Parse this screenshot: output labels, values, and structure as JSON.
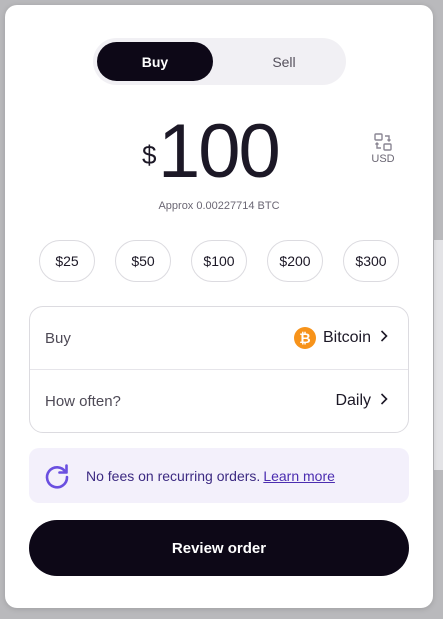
{
  "toggle": {
    "buy_label": "Buy",
    "sell_label": "Sell",
    "active": "Buy"
  },
  "amount": {
    "currency_symbol": "$",
    "value": "100",
    "swap_label": "USD",
    "approx": "Approx 0.00227714 BTC"
  },
  "presets": [
    "$25",
    "$50",
    "$100",
    "$200",
    "$300"
  ],
  "asset_row": {
    "label": "Buy",
    "value": "Bitcoin",
    "icon": "bitcoin-icon",
    "icon_glyph": "₿",
    "icon_color": "#f7931a"
  },
  "frequency_row": {
    "label": "How often?",
    "value": "Daily"
  },
  "info": {
    "text": "No fees on recurring orders.",
    "link": "Learn more",
    "icon": "refresh-icon"
  },
  "review_button": "Review order",
  "colors": {
    "primary": "#0d0817",
    "accent": "#5b3fd0",
    "info_bg": "#f3f0fb",
    "bitcoin": "#f7931a"
  }
}
